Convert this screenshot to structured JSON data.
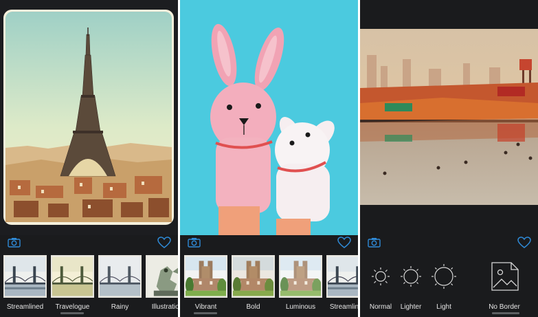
{
  "screens": [
    {
      "filters": [
        {
          "label": "Streamlined",
          "selected": false
        },
        {
          "label": "Travelogue",
          "selected": true
        },
        {
          "label": "Rainy",
          "selected": false
        },
        {
          "label": "Illustration",
          "selected": false
        }
      ]
    },
    {
      "filters": [
        {
          "label": "Vibrant",
          "selected": true
        },
        {
          "label": "Bold",
          "selected": false
        },
        {
          "label": "Luminous",
          "selected": false
        },
        {
          "label": "Streamlined",
          "selected": false
        }
      ]
    },
    {
      "borders": [
        {
          "label": "Normal",
          "icon": "sun-small-icon"
        },
        {
          "label": "Lighter",
          "icon": "sun-medium-icon"
        },
        {
          "label": "Light",
          "icon": "sun-large-icon"
        },
        {
          "label": "No Border",
          "icon": "no-border-icon",
          "selected": true
        }
      ]
    }
  ],
  "colors": {
    "accent": "#2f8bd8",
    "toolbar_bg": "#1a1b1d",
    "label_text": "#e6e6e6"
  }
}
